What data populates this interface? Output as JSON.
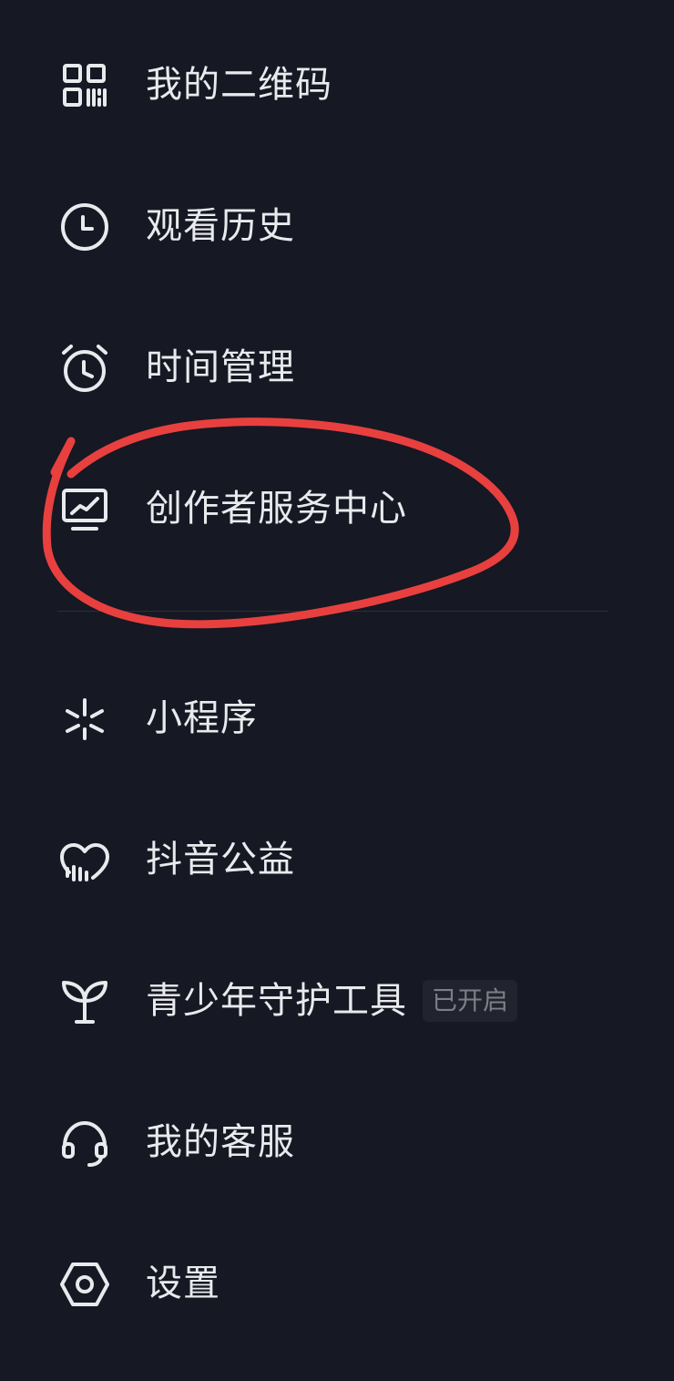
{
  "menu": {
    "items": [
      {
        "label": "我的二维码",
        "icon": "qr-code-icon"
      },
      {
        "label": "观看历史",
        "icon": "clock-icon"
      },
      {
        "label": "时间管理",
        "icon": "alarm-clock-icon"
      },
      {
        "label": "创作者服务中心",
        "icon": "monitor-chart-icon"
      },
      {
        "label": "小程序",
        "icon": "mini-program-icon"
      },
      {
        "label": "抖音公益",
        "icon": "heart-charity-icon"
      },
      {
        "label": "青少年守护工具",
        "icon": "sprout-icon",
        "badge": "已开启"
      },
      {
        "label": "我的客服",
        "icon": "headset-icon"
      },
      {
        "label": "设置",
        "icon": "hexagon-settings-icon"
      }
    ]
  },
  "colors": {
    "background": "#161823",
    "text": "#e9eaed",
    "badge_text": "#7d7f88",
    "badge_bg": "#21232e",
    "annotation": "#e8403f"
  }
}
